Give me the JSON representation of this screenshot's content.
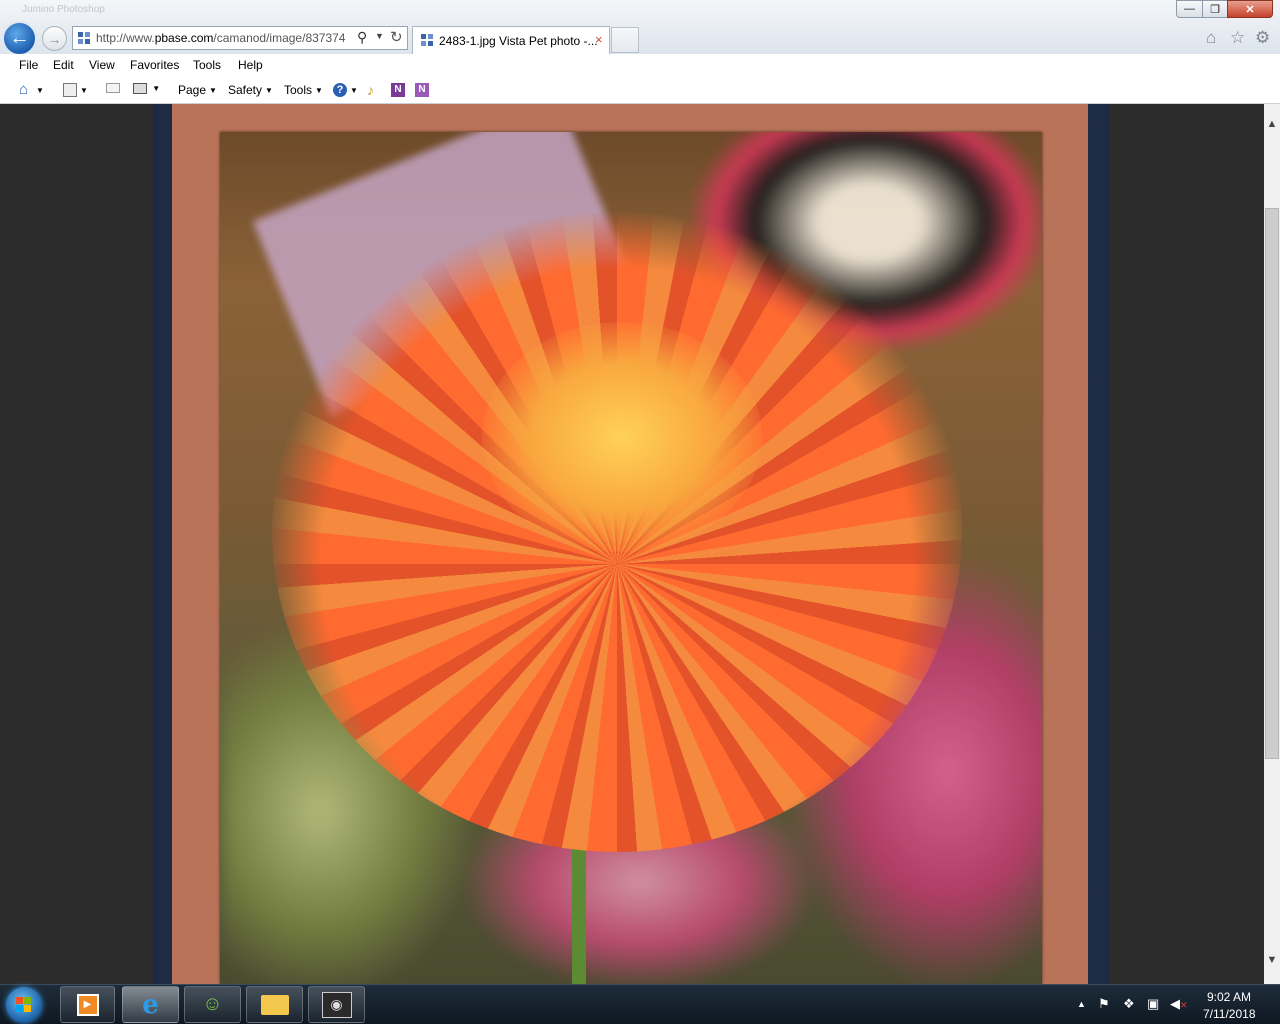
{
  "window": {
    "ghost_title": "Jumino Photoshop",
    "controls": {
      "minimize": "—",
      "maximize": "❐",
      "close": "✕"
    }
  },
  "address": {
    "url_prefix": "http://www.",
    "url_domain": "pbase.com",
    "url_rest": "/camanod/image/837374"
  },
  "tab": {
    "title": "2483-1.jpg Vista Pet photo -...",
    "close": "×"
  },
  "menu": [
    "File",
    "Edit",
    "View",
    "Favorites",
    "Tools",
    "Help"
  ],
  "commandbar": {
    "page": "Page",
    "safety": "Safety",
    "tools": "Tools"
  },
  "photo": {
    "subject": "orange cactus dahlia"
  },
  "taskbar": {
    "clock_time": "9:02 AM",
    "clock_date": "7/11/2018"
  },
  "icons": {
    "back": "←",
    "forward": "→",
    "search": "⚲",
    "refresh": "↻",
    "home": "⌂",
    "favorites": "☆",
    "settings": "⚙",
    "scroll_up": "▲",
    "scroll_down": "▼",
    "tray_arrow": "▲"
  },
  "colors": {
    "frame_mat": "#b97358",
    "taskbar": "#0e1822",
    "back_button": "#1d5fb2"
  }
}
